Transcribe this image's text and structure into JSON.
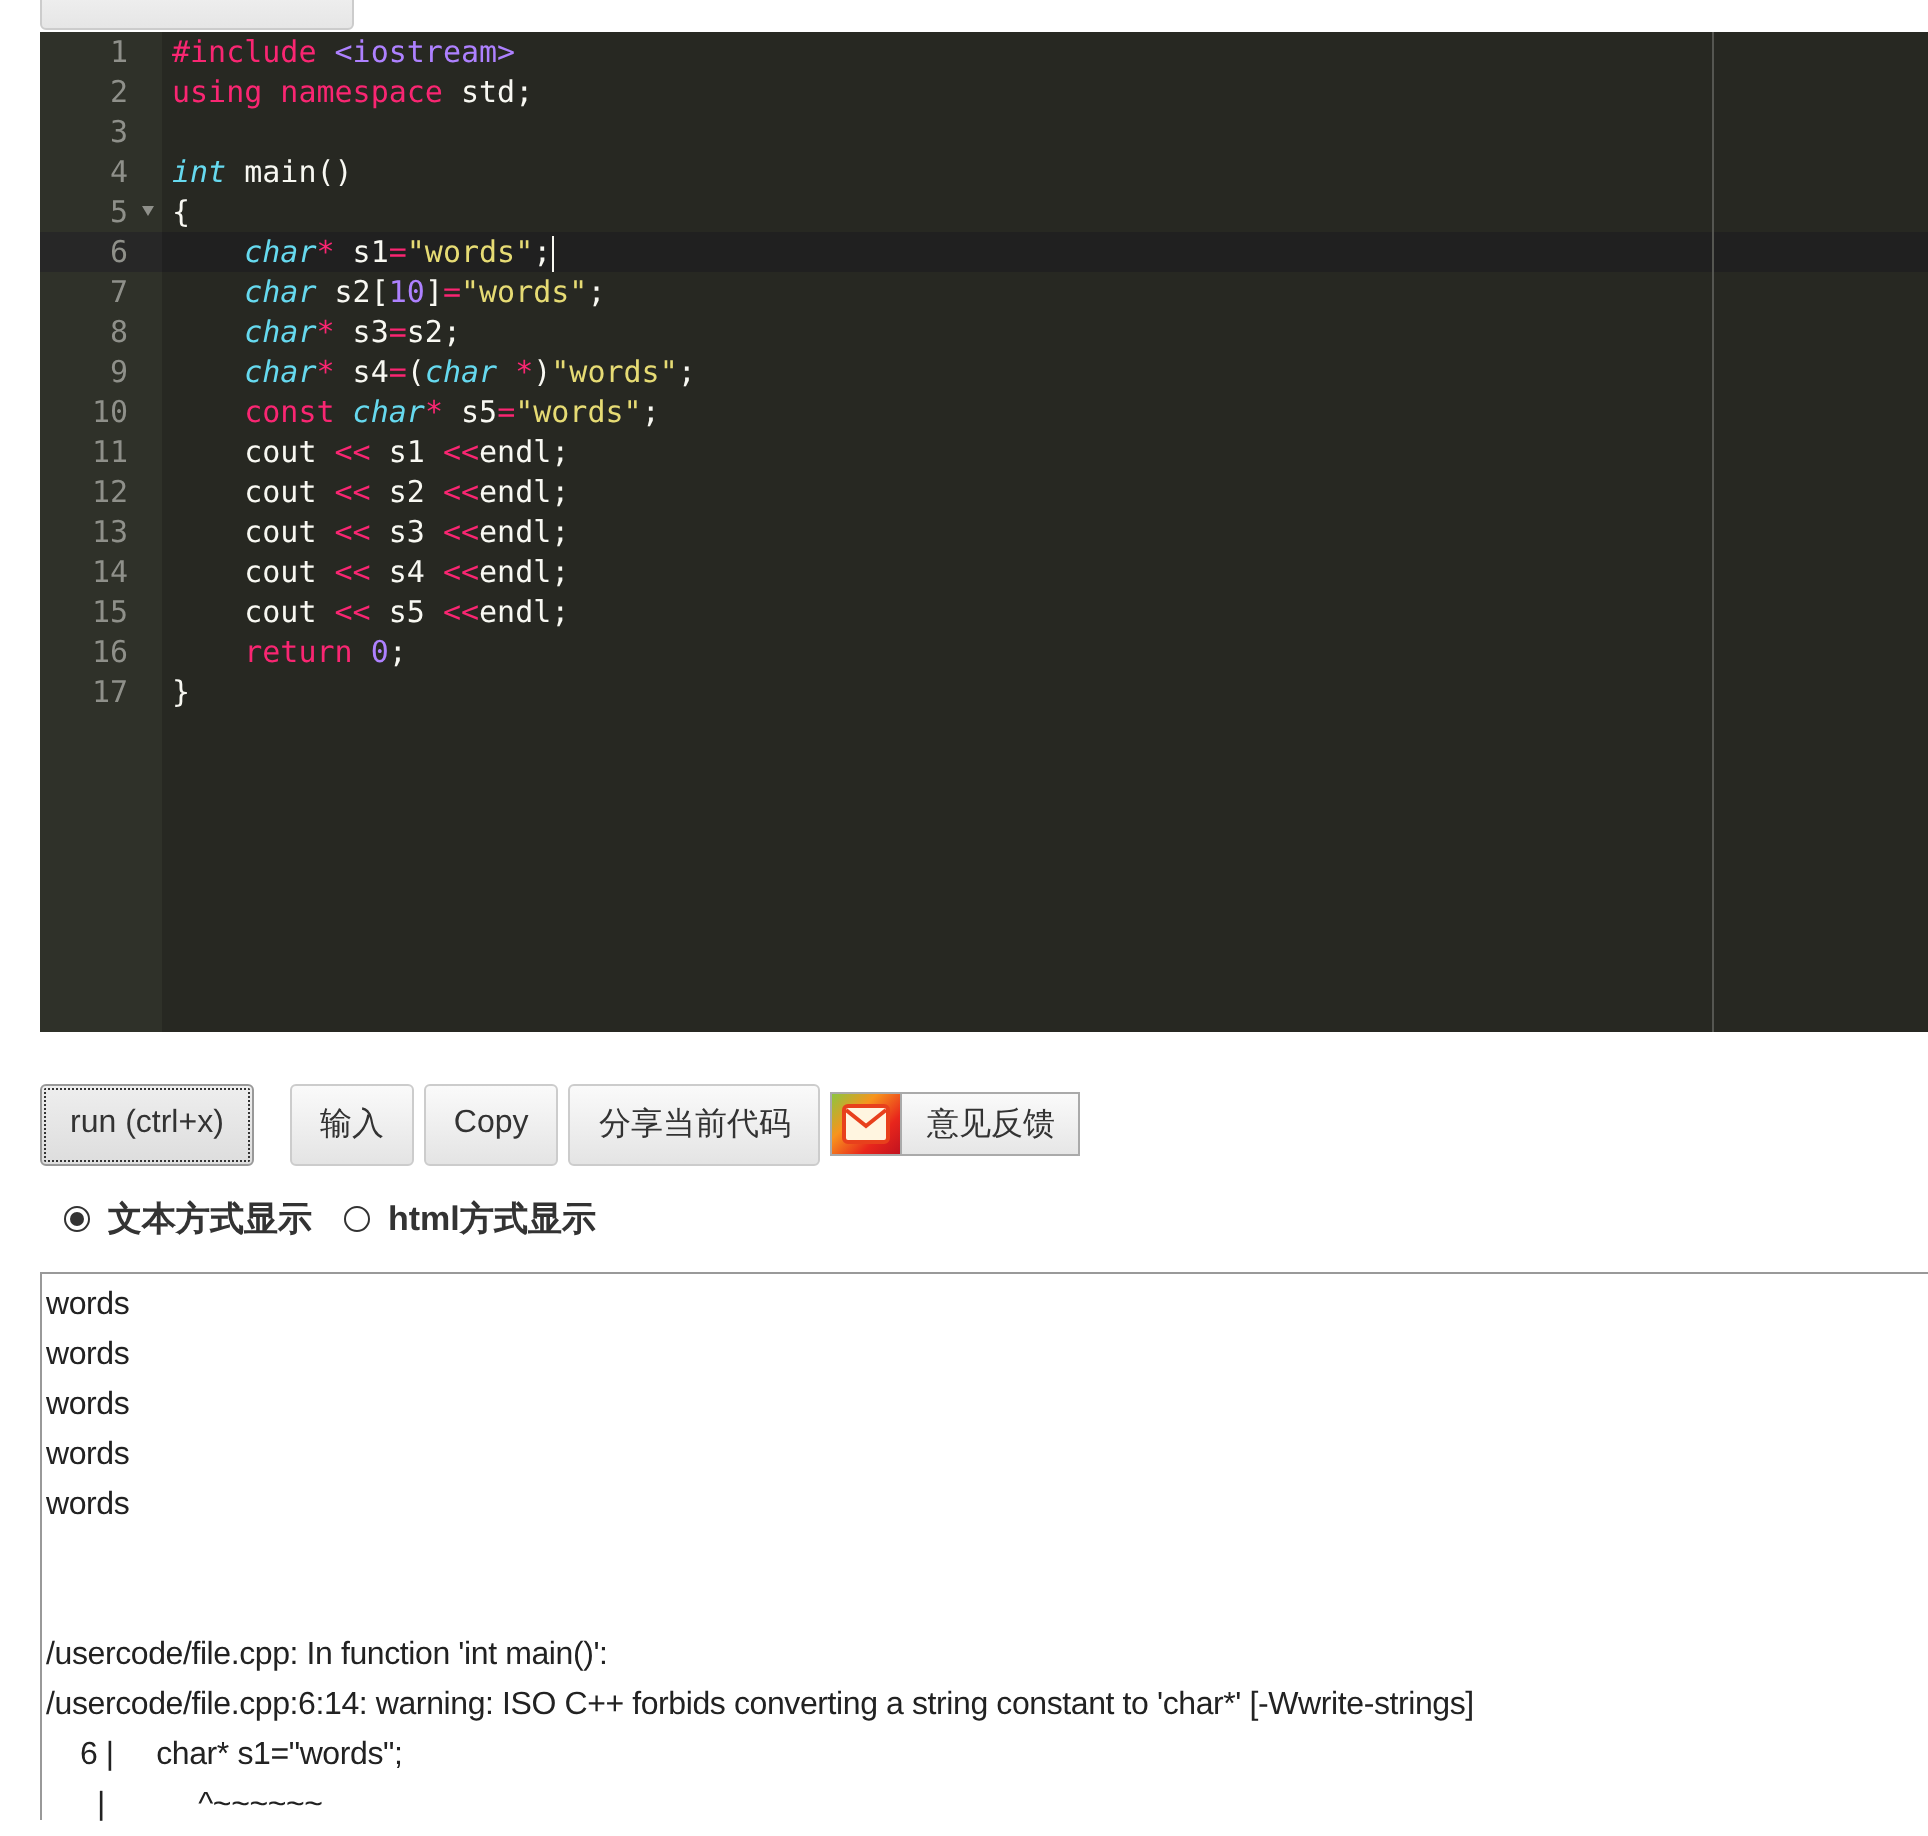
{
  "editor": {
    "lines": [
      {
        "number": "1",
        "tokens": [
          {
            "text": "#include",
            "kind": "keyword"
          },
          {
            "text": " <iostream>",
            "kind": "constant"
          }
        ]
      },
      {
        "number": "2",
        "tokens": [
          {
            "text": "using",
            "kind": "keyword"
          },
          {
            "text": " namespace",
            "kind": "keyword"
          },
          {
            "text": " std;",
            "kind": "plain"
          }
        ]
      },
      {
        "number": "3"
      },
      {
        "number": "4",
        "tokens": [
          {
            "text": "int",
            "kind": "type"
          },
          {
            "text": " main()",
            "kind": "plain"
          }
        ]
      },
      {
        "number": "5",
        "foldable": true,
        "tokens": [
          {
            "text": "{",
            "kind": "plain"
          }
        ]
      },
      {
        "number": "6",
        "active": true,
        "tokens": [
          {
            "text": "    char",
            "kind": "type"
          },
          {
            "text": "*",
            "kind": "keyword"
          },
          {
            "text": " s1",
            "kind": "plain"
          },
          {
            "text": "=",
            "kind": "keyword"
          },
          {
            "text": "\"words\"",
            "kind": "string"
          },
          {
            "text": ";",
            "kind": "plain"
          }
        ]
      },
      {
        "number": "7",
        "tokens": [
          {
            "text": "    char",
            "kind": "type"
          },
          {
            "text": " s2[",
            "kind": "plain"
          },
          {
            "text": "10",
            "kind": "constant"
          },
          {
            "text": "]",
            "kind": "plain"
          },
          {
            "text": "=",
            "kind": "keyword"
          },
          {
            "text": "\"words\"",
            "kind": "string"
          },
          {
            "text": ";",
            "kind": "plain"
          }
        ]
      },
      {
        "number": "8",
        "tokens": [
          {
            "text": "    char",
            "kind": "type"
          },
          {
            "text": "*",
            "kind": "keyword"
          },
          {
            "text": " s3",
            "kind": "plain"
          },
          {
            "text": "=",
            "kind": "keyword"
          },
          {
            "text": "s2;",
            "kind": "plain"
          }
        ]
      },
      {
        "number": "9",
        "tokens": [
          {
            "text": "    char",
            "kind": "type"
          },
          {
            "text": "*",
            "kind": "keyword"
          },
          {
            "text": " s4",
            "kind": "plain"
          },
          {
            "text": "=",
            "kind": "keyword"
          },
          {
            "text": "(",
            "kind": "plain"
          },
          {
            "text": "char",
            "kind": "type"
          },
          {
            "text": " *",
            "kind": "keyword"
          },
          {
            "text": ")",
            "kind": "plain"
          },
          {
            "text": "\"words\"",
            "kind": "string"
          },
          {
            "text": ";",
            "kind": "plain"
          }
        ]
      },
      {
        "number": "10",
        "tokens": [
          {
            "text": "    const",
            "kind": "keyword"
          },
          {
            "text": " char",
            "kind": "type"
          },
          {
            "text": "*",
            "kind": "keyword"
          },
          {
            "text": " s5",
            "kind": "plain"
          },
          {
            "text": "=",
            "kind": "keyword"
          },
          {
            "text": "\"words\"",
            "kind": "string"
          },
          {
            "text": ";",
            "kind": "plain"
          }
        ]
      },
      {
        "number": "11",
        "tokens": [
          {
            "text": "    cout ",
            "kind": "plain"
          },
          {
            "text": "<<",
            "kind": "keyword"
          },
          {
            "text": " s1 ",
            "kind": "plain"
          },
          {
            "text": "<<",
            "kind": "keyword"
          },
          {
            "text": "endl;",
            "kind": "plain"
          }
        ]
      },
      {
        "number": "12",
        "tokens": [
          {
            "text": "    cout ",
            "kind": "plain"
          },
          {
            "text": "<<",
            "kind": "keyword"
          },
          {
            "text": " s2 ",
            "kind": "plain"
          },
          {
            "text": "<<",
            "kind": "keyword"
          },
          {
            "text": "endl;",
            "kind": "plain"
          }
        ]
      },
      {
        "number": "13",
        "tokens": [
          {
            "text": "    cout ",
            "kind": "plain"
          },
          {
            "text": "<<",
            "kind": "keyword"
          },
          {
            "text": " s3 ",
            "kind": "plain"
          },
          {
            "text": "<<",
            "kind": "keyword"
          },
          {
            "text": "endl;",
            "kind": "plain"
          }
        ]
      },
      {
        "number": "14",
        "tokens": [
          {
            "text": "    cout ",
            "kind": "plain"
          },
          {
            "text": "<<",
            "kind": "keyword"
          },
          {
            "text": " s4 ",
            "kind": "plain"
          },
          {
            "text": "<<",
            "kind": "keyword"
          },
          {
            "text": "endl;",
            "kind": "plain"
          }
        ]
      },
      {
        "number": "15",
        "tokens": [
          {
            "text": "    cout ",
            "kind": "plain"
          },
          {
            "text": "<<",
            "kind": "keyword"
          },
          {
            "text": " s5 ",
            "kind": "plain"
          },
          {
            "text": "<<",
            "kind": "keyword"
          },
          {
            "text": "endl;",
            "kind": "plain"
          }
        ]
      },
      {
        "number": "16",
        "tokens": [
          {
            "text": "    return",
            "kind": "keyword"
          },
          {
            "text": " 0",
            "kind": "constant"
          },
          {
            "text": ";",
            "kind": "plain"
          }
        ]
      },
      {
        "number": "17",
        "tokens": [
          {
            "text": "}",
            "kind": "plain"
          }
        ]
      }
    ]
  },
  "buttons": [
    {
      "label": "run (ctrl+x)",
      "kind": "focused"
    },
    {
      "label": "输入",
      "kind": "plain"
    },
    {
      "label": "Copy",
      "kind": "plain"
    },
    {
      "label": "分享当前代码",
      "kind": "plain"
    },
    {
      "label": "意见反馈",
      "kind": "feedback"
    }
  ],
  "display_modes": [
    {
      "label": "文本方式显示",
      "selected": true
    },
    {
      "label": "html方式显示",
      "selected": false
    }
  ],
  "output": {
    "program_output": [
      "words",
      "words",
      "words",
      "words",
      "words"
    ],
    "compiler_messages": [
      "/usercode/file.cpp: In function 'int main()':",
      "/usercode/file.cpp:6:14: warning: ISO C++ forbids converting a string constant to 'char*' [-Wwrite-strings]",
      "    6 |     char* s1=\"words\";",
      "      |           ^~~~~~~"
    ]
  }
}
